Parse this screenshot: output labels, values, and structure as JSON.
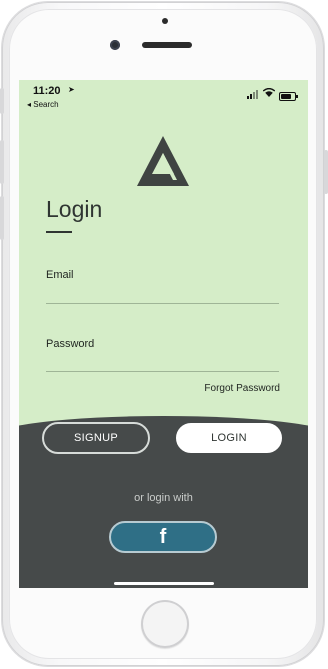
{
  "status_bar": {
    "time": "11:20",
    "location_glyph": "➤",
    "back_link": "◂ Search"
  },
  "login": {
    "title": "Login",
    "email_label": "Email",
    "email_value": "",
    "password_label": "Password",
    "password_value": "",
    "forgot_password": "Forgot Password"
  },
  "actions": {
    "signup_label": "SIGNUP",
    "login_label": "LOGIN"
  },
  "social": {
    "or_text": "or login with",
    "facebook_glyph": "f"
  },
  "colors": {
    "screen_bg": "#d5edc8",
    "dark_panel": "#464a4a",
    "facebook": "#2f6f86",
    "text": "#2f3532"
  },
  "icons": [
    "location-arrow-icon",
    "signal-icon",
    "wifi-icon",
    "battery-icon",
    "app-logo-icon",
    "facebook-icon"
  ]
}
